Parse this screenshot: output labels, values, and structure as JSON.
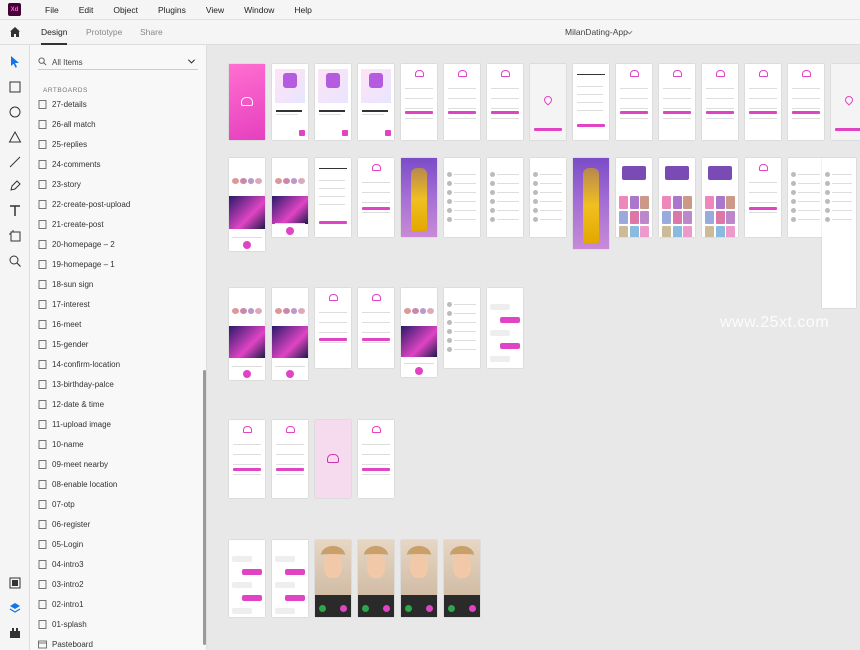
{
  "app": {
    "logo": "Xd"
  },
  "menu": [
    "File",
    "Edit",
    "Object",
    "Plugins",
    "View",
    "Window",
    "Help"
  ],
  "tabs": {
    "design": "Design",
    "prototype": "Prototype",
    "share": "Share"
  },
  "document": {
    "title": "MilanDating-App"
  },
  "layers_panel": {
    "search_label": "All Items",
    "section_label": "ARTBOARDS",
    "items": [
      "27-details",
      "26-all match",
      "25-replies",
      "24-comments",
      "23-story",
      "22-create-post-upload",
      "21-create-post",
      "20-homepage – 2",
      "19-homepage – 1",
      "18-sun sign",
      "17-interest",
      "16-meet",
      "15-gender",
      "14-confirm-location",
      "13-birthday-palce",
      "12-date & time",
      "11-upload image",
      "10-name",
      "09-meet nearby",
      "08-enable location",
      "07-otp",
      "06-register",
      "05-Login",
      "04-intro3",
      "03-intro2",
      "02-intro1",
      "01-splash",
      "Pasteboard"
    ]
  },
  "canvas": {
    "watermark": "www.25xt.com"
  },
  "colors": {
    "accent": "#e044c4",
    "brand_dark": "#470137",
    "brand_pink": "#ff61f6"
  },
  "icons": [
    "home-icon",
    "select-icon",
    "rectangle-icon",
    "ellipse-icon",
    "triangle-icon",
    "line-icon",
    "pen-icon",
    "text-icon",
    "artboard-icon",
    "zoom-icon",
    "assets-icon",
    "layers-icon",
    "plugins-icon",
    "search-icon",
    "chevron-down-icon",
    "artboard-layer-icon"
  ]
}
